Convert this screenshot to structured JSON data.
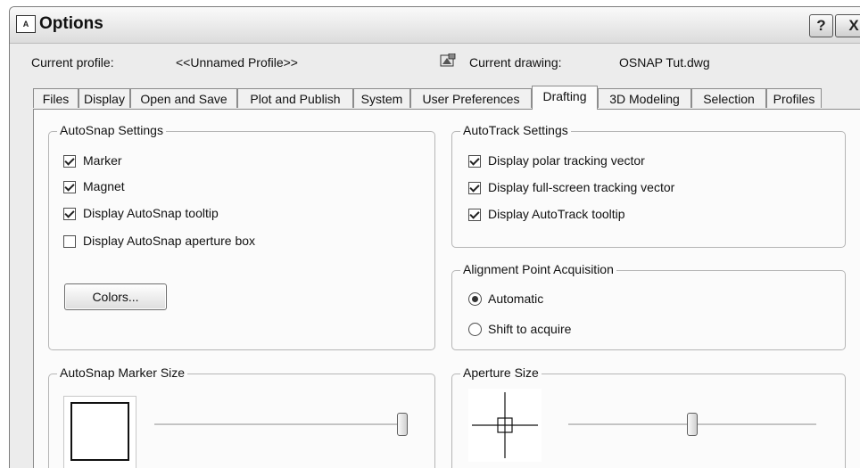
{
  "window": {
    "title": "Options",
    "app_icon_text": "A",
    "help_label": "?",
    "close_label": "X"
  },
  "header": {
    "profile_label": "Current profile:",
    "profile_value": "<<Unnamed Profile>>",
    "drawing_label": "Current drawing:",
    "drawing_value": "OSNAP Tut.dwg",
    "drawing_icon": "drawing-file-icon"
  },
  "tabs": [
    {
      "label": "Files"
    },
    {
      "label": "Display"
    },
    {
      "label": "Open and Save"
    },
    {
      "label": "Plot and Publish"
    },
    {
      "label": "System"
    },
    {
      "label": "User Preferences"
    },
    {
      "label": "Drafting",
      "active": true
    },
    {
      "label": "3D Modeling"
    },
    {
      "label": "Selection"
    },
    {
      "label": "Profiles"
    }
  ],
  "autosnap": {
    "title": "AutoSnap Settings",
    "marker": {
      "label": "Marker",
      "checked": true
    },
    "magnet": {
      "label": "Magnet",
      "checked": true
    },
    "tooltip": {
      "label": "Display AutoSnap tooltip",
      "checked": true
    },
    "aperture_box": {
      "label": "Display AutoSnap aperture box",
      "checked": false
    },
    "colors_button": "Colors..."
  },
  "autotrack": {
    "title": "AutoTrack Settings",
    "polar": {
      "label": "Display polar tracking vector",
      "checked": true
    },
    "fullscreen": {
      "label": "Display full-screen tracking vector",
      "checked": true
    },
    "tooltip": {
      "label": "Display AutoTrack tooltip",
      "checked": true
    }
  },
  "alignment": {
    "title": "Alignment Point Acquisition",
    "automatic": {
      "label": "Automatic",
      "selected": true
    },
    "shift": {
      "label": "Shift to acquire",
      "selected": false
    }
  },
  "marker_size": {
    "title": "AutoSnap Marker Size",
    "slider_fraction": 1.0
  },
  "aperture_size": {
    "title": "Aperture Size",
    "slider_fraction": 0.5
  },
  "colors": {
    "window_bg": "#ececec",
    "page_bg": "#fbfbfb"
  }
}
